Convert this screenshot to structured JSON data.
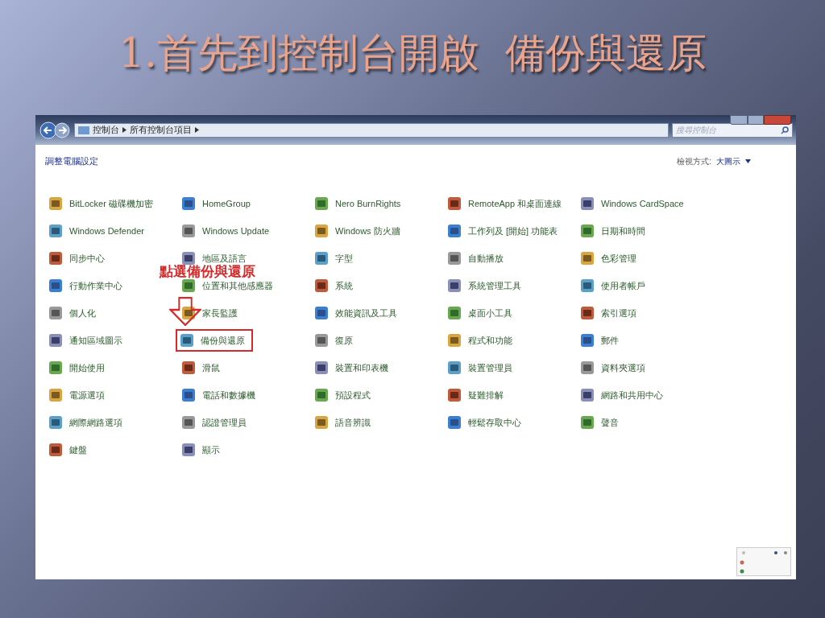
{
  "slide": {
    "title": "1.首先到控制台開啟  備份與還原"
  },
  "window": {
    "breadcrumb": [
      "控制台",
      "所有控制台項目"
    ],
    "search": {
      "placeholder": "搜尋控制台"
    },
    "heading": "調整電腦設定",
    "view_by": {
      "label": "檢視方式:",
      "value": "大圖示"
    }
  },
  "items": [
    {
      "label": "BitLocker 磁碟機加密",
      "highlighted": false
    },
    {
      "label": "HomeGroup",
      "highlighted": false
    },
    {
      "label": "Nero BurnRights",
      "highlighted": false
    },
    {
      "label": "RemoteApp 和桌面連線",
      "highlighted": false
    },
    {
      "label": "Windows CardSpace",
      "highlighted": false
    },
    {
      "label": "Windows Defender",
      "highlighted": false
    },
    {
      "label": "Windows Update",
      "highlighted": false
    },
    {
      "label": "Windows 防火牆",
      "highlighted": false
    },
    {
      "label": "工作列及 [開始] 功能表",
      "highlighted": false
    },
    {
      "label": "日期和時間",
      "highlighted": false
    },
    {
      "label": "同步中心",
      "highlighted": false
    },
    {
      "label": "地區及語言",
      "highlighted": false
    },
    {
      "label": "字型",
      "highlighted": false
    },
    {
      "label": "自動播放",
      "highlighted": false
    },
    {
      "label": "色彩管理",
      "highlighted": false
    },
    {
      "label": "行動作業中心",
      "highlighted": false
    },
    {
      "label": "位置和其他感應器",
      "highlighted": false
    },
    {
      "label": "系統",
      "highlighted": false
    },
    {
      "label": "系統管理工具",
      "highlighted": false
    },
    {
      "label": "使用者帳戶",
      "highlighted": false
    },
    {
      "label": "個人化",
      "highlighted": false
    },
    {
      "label": "家長監護",
      "highlighted": false
    },
    {
      "label": "效能資訊及工具",
      "highlighted": false
    },
    {
      "label": "桌面小工具",
      "highlighted": false
    },
    {
      "label": "索引選項",
      "highlighted": false
    },
    {
      "label": "通知區域圖示",
      "highlighted": false
    },
    {
      "label": "備份與還原",
      "highlighted": true
    },
    {
      "label": "復原",
      "highlighted": false
    },
    {
      "label": "程式和功能",
      "highlighted": false
    },
    {
      "label": "郵件",
      "highlighted": false
    },
    {
      "label": "開始使用",
      "highlighted": false
    },
    {
      "label": "滑鼠",
      "highlighted": false
    },
    {
      "label": "裝置和印表機",
      "highlighted": false
    },
    {
      "label": "裝置管理員",
      "highlighted": false
    },
    {
      "label": "資料夾選項",
      "highlighted": false
    },
    {
      "label": "電源選項",
      "highlighted": false
    },
    {
      "label": "電話和數據機",
      "highlighted": false
    },
    {
      "label": "預設程式",
      "highlighted": false
    },
    {
      "label": "疑難排解",
      "highlighted": false
    },
    {
      "label": "網路和共用中心",
      "highlighted": false
    },
    {
      "label": "網際網路選項",
      "highlighted": false
    },
    {
      "label": "認證管理員",
      "highlighted": false
    },
    {
      "label": "語音辨識",
      "highlighted": false
    },
    {
      "label": "輕鬆存取中心",
      "highlighted": false
    },
    {
      "label": "聲音",
      "highlighted": false
    },
    {
      "label": "鍵盤",
      "highlighted": false
    },
    {
      "label": "顯示",
      "highlighted": false
    }
  ],
  "annotation": {
    "text": "點選備份與還原"
  }
}
